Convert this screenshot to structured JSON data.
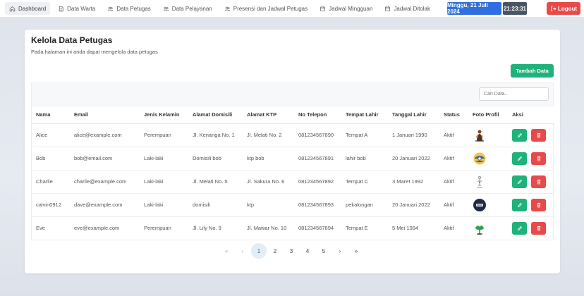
{
  "nav": {
    "items": [
      {
        "label": "Dashboard",
        "icon": "home-icon",
        "active": true
      },
      {
        "label": "Data Warta",
        "icon": "document-icon"
      },
      {
        "label": "Data Petugas",
        "icon": "users-icon"
      },
      {
        "label": "Data Pelayanan",
        "icon": "users-icon"
      },
      {
        "label": "Presensi dan Jadwal Petugas",
        "icon": "users-icon"
      },
      {
        "label": "Jadwal Mingguan",
        "icon": "calendar-icon"
      },
      {
        "label": "Jadwal Ditolak",
        "icon": "calendar-icon"
      }
    ],
    "date": "Minggu, 21 Juli 2024",
    "time": "21:23:31",
    "logout_label": "Logout"
  },
  "page": {
    "title": "Kelola Data Petugas",
    "subtitle": "Pada halaman ini anda dapat mengelola data petugas",
    "add_label": "Tambah Data",
    "search_placeholder": "Cari Data.."
  },
  "table": {
    "headers": [
      "Nama",
      "Email",
      "Jenis Kelamin",
      "Alamat Domisili",
      "Alamat KTP",
      "No Telepon",
      "Tempat Lahir",
      "Tanggal Lahir",
      "Status",
      "Foto Profil",
      "Aksi"
    ],
    "rows": [
      {
        "nama": "Alice",
        "email": "alice@example.com",
        "jk": "Perempuan",
        "domisili": "Jl. Kenanga No. 1",
        "ktp": "Jl. Melati No. 2",
        "telp": "081234567890",
        "tempat": "Tempat A",
        "tanggal": "1 Januari 1990",
        "status": "Aktif",
        "photo": "figure-icon"
      },
      {
        "nama": "Bob",
        "email": "bob@email.com",
        "jk": "Laki-laki",
        "domisili": "Domisili bob",
        "ktp": "ktp bob",
        "telp": "081234567891",
        "tempat": "lahir bob",
        "tanggal": "20 Januari 2022",
        "status": "Aktif",
        "photo": "emblem-icon"
      },
      {
        "nama": "Charlie",
        "email": "charlie@example.com",
        "jk": "Laki-laki",
        "domisili": "Jl. Melati No. 5",
        "ktp": "Jl. Sakura No. 6",
        "telp": "081234567892",
        "tempat": "Tempat C",
        "tanggal": "3 Maret 1992",
        "status": "Aktif",
        "photo": "lamp-icon"
      },
      {
        "nama": "calvin0912",
        "email": "dave@example.com",
        "jk": "Laki-laki",
        "domisili": "domisili",
        "ktp": "ktp",
        "telp": "081234567893",
        "tempat": "pekalongan",
        "tanggal": "20 Januari 2022",
        "status": "Aktif",
        "photo": "badge-icon"
      },
      {
        "nama": "Eve",
        "email": "eve@example.com",
        "jk": "Perempuan",
        "domisili": "Jl. Lily No. 9",
        "ktp": "Jl. Mawar No. 10",
        "telp": "081234567894",
        "tempat": "Tempat E",
        "tanggal": "5 Mei 1994",
        "status": "Aktif",
        "photo": "plant-icon"
      }
    ]
  },
  "pagination": {
    "first": "«",
    "prev": "‹",
    "pages": [
      "1",
      "2",
      "3",
      "4",
      "5"
    ],
    "active": "1",
    "next": "›",
    "last": "»"
  },
  "colors": {
    "primary": "#2f6fe0",
    "success": "#1fb27a",
    "danger": "#e84a4a",
    "dark": "#4a5563"
  }
}
